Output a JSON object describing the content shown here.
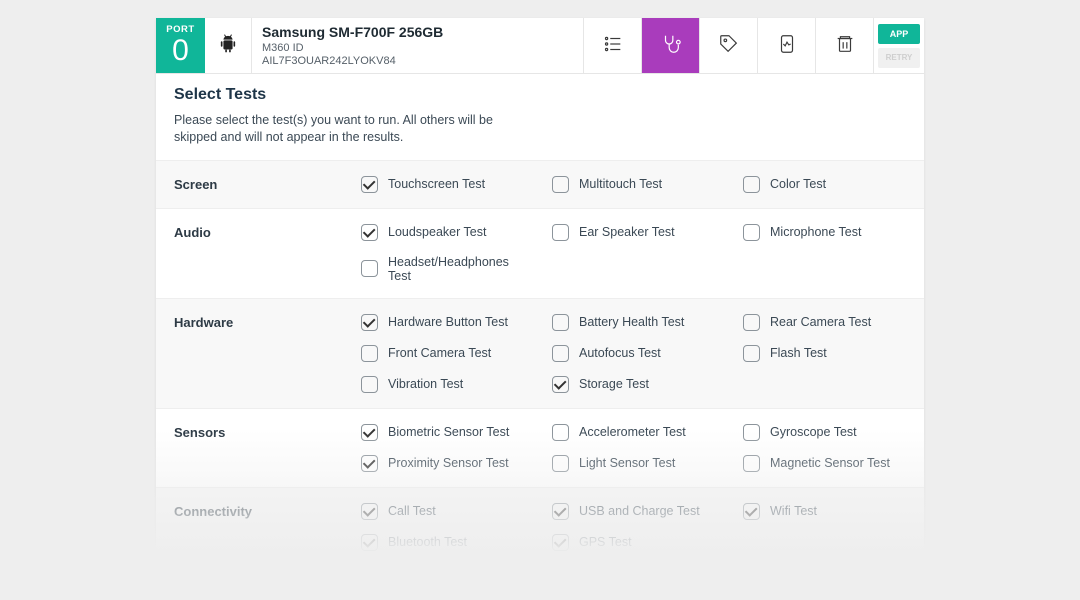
{
  "header": {
    "port_label": "PORT",
    "port_number": "0",
    "device_model": "Samsung SM-F700F 256GB",
    "device_id_label": "M360 ID",
    "device_id_value": "AIL7F3OUAR242LYOKV84",
    "app_button": "APP",
    "retry_button": "RETRY"
  },
  "body": {
    "title": "Select Tests",
    "description": "Please select the test(s) you want to run. All others will be skipped and will not appear in the results."
  },
  "categories": [
    {
      "label": "Screen",
      "tests": [
        {
          "label": "Touchscreen Test",
          "checked": true
        },
        {
          "label": "Multitouch Test",
          "checked": false
        },
        {
          "label": "Color Test",
          "checked": false
        }
      ]
    },
    {
      "label": "Audio",
      "tests": [
        {
          "label": "Loudspeaker Test",
          "checked": true
        },
        {
          "label": "Ear Speaker Test",
          "checked": false
        },
        {
          "label": "Microphone Test",
          "checked": false
        },
        {
          "label": "Headset/Headphones Test",
          "checked": false
        }
      ]
    },
    {
      "label": "Hardware",
      "tests": [
        {
          "label": "Hardware Button Test",
          "checked": true
        },
        {
          "label": "Battery Health Test",
          "checked": false
        },
        {
          "label": "Rear Camera Test",
          "checked": false
        },
        {
          "label": "Front Camera Test",
          "checked": false
        },
        {
          "label": "Autofocus Test",
          "checked": false
        },
        {
          "label": "Flash Test",
          "checked": false
        },
        {
          "label": "Vibration Test",
          "checked": false
        },
        {
          "label": "Storage Test",
          "checked": true
        }
      ]
    },
    {
      "label": "Sensors",
      "tests": [
        {
          "label": "Biometric Sensor Test",
          "checked": true
        },
        {
          "label": "Accelerometer Test",
          "checked": false
        },
        {
          "label": "Gyroscope Test",
          "checked": false
        },
        {
          "label": "Proximity Sensor Test",
          "checked": true
        },
        {
          "label": "Light Sensor Test",
          "checked": false
        },
        {
          "label": "Magnetic Sensor Test",
          "checked": false
        }
      ]
    },
    {
      "label": "Connectivity",
      "tests": [
        {
          "label": "Call Test",
          "checked": true
        },
        {
          "label": "USB and Charge Test",
          "checked": true
        },
        {
          "label": "Wifi Test",
          "checked": true
        },
        {
          "label": "Bluetooth Test",
          "checked": true
        },
        {
          "label": "GPS Test",
          "checked": true
        }
      ]
    }
  ]
}
